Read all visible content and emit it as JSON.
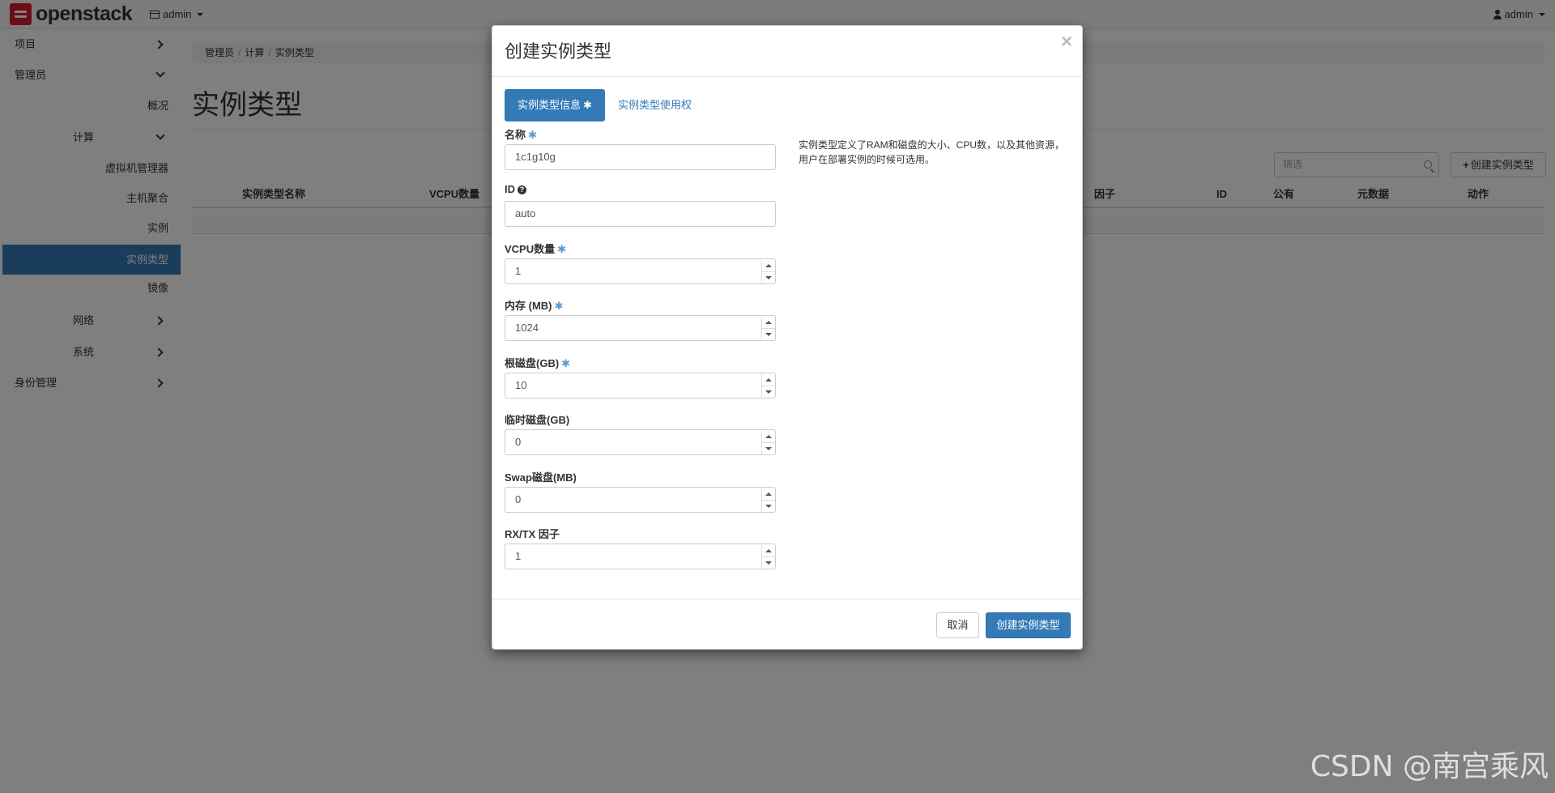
{
  "navbar": {
    "brand": "openstack",
    "project": "admin",
    "user": "admin"
  },
  "sidebar": {
    "project": "项目",
    "admin": "管理员",
    "overview": "概况",
    "compute": "计算",
    "hypervisors": "虚拟机管理器",
    "host_aggregates": "主机聚合",
    "instances": "实例",
    "flavors": "实例类型",
    "images": "镜像",
    "network": "网络",
    "system": "系统",
    "identity": "身份管理"
  },
  "breadcrumb": [
    "管理员",
    "计算",
    "实例类型"
  ],
  "page": {
    "title": "实例类型",
    "filter_placeholder": "筛选",
    "create_button": "创建实例类型",
    "columns": [
      "实例类型名称",
      "VCPU数量",
      "因子",
      "ID",
      "公有",
      "元数据",
      "动作"
    ]
  },
  "modal": {
    "title": "创建实例类型",
    "close": "×",
    "tabs": [
      "实例类型信息",
      "实例类型使用权"
    ],
    "fields": {
      "name_label": "名称",
      "name_value": "1c1g10g",
      "id_label": "ID",
      "id_value": "auto",
      "vcpu_label": "VCPU数量",
      "vcpu_value": "1",
      "ram_label": "内存 (MB)",
      "ram_value": "1024",
      "root_disk_label": "根磁盘(GB)",
      "root_disk_value": "10",
      "ephemeral_label": "临时磁盘(GB)",
      "ephemeral_value": "0",
      "swap_label": "Swap磁盘(MB)",
      "swap_value": "0",
      "rxtx_label": "RX/TX 因子",
      "rxtx_value": "1"
    },
    "description": "实例类型定义了RAM和磁盘的大小、CPU数，以及其他资源，用户在部署实例的时候可选用。",
    "cancel": "取消",
    "submit": "创建实例类型"
  },
  "watermark": "CSDN @南宫乘风",
  "colors": {
    "primary": "#337ab7",
    "brand": "#da1a32",
    "required": "#5b9bd5"
  }
}
